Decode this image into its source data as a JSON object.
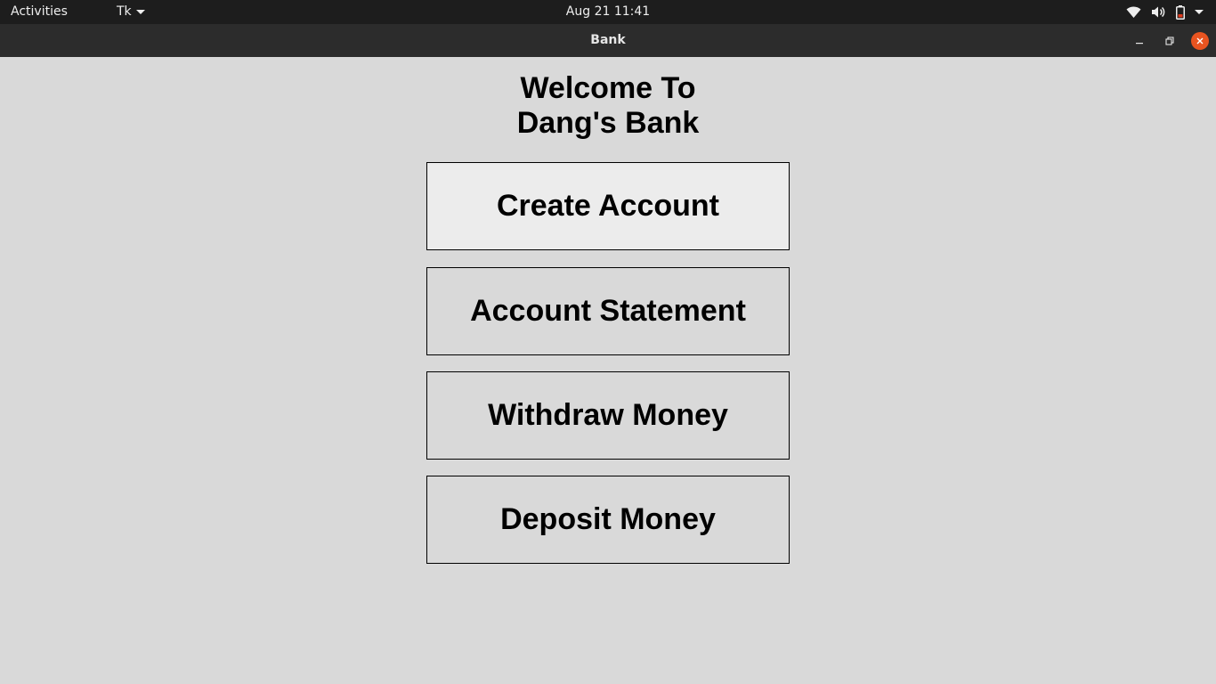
{
  "topbar": {
    "activities_label": "Activities",
    "app_menu_label": "Tk",
    "clock": "Aug 21  11:41",
    "icons": [
      "wifi-icon",
      "volume-icon",
      "battery-icon",
      "system-menu-chevron-icon"
    ]
  },
  "window": {
    "title": "Bank",
    "controls": [
      "minimize-icon",
      "maximize-icon",
      "close-icon"
    ],
    "close_color": "#e95420"
  },
  "app": {
    "heading_line1": "Welcome To",
    "heading_line2": "Dang's Bank",
    "buttons": [
      {
        "label": "Create Account"
      },
      {
        "label": "Account Statement"
      },
      {
        "label": "Withdraw Money"
      },
      {
        "label": "Deposit Money"
      }
    ]
  }
}
